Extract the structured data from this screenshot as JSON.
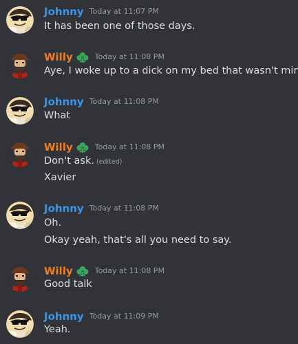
{
  "colors": {
    "background": "#313338",
    "johnny_name": "#3b95e6",
    "willy_name": "#ef7b21",
    "badge": "#3ba55d",
    "timestamp": "#949ba4",
    "text": "#dbdee1"
  },
  "messages": [
    {
      "author": "Johnny",
      "timestamp": "Today at 11:07 PM",
      "avatar_icon": "johnny-avatar-icon",
      "lines": [
        "It has been one of those days."
      ]
    },
    {
      "author": "Willy",
      "badge_icon": "leaf-badge-icon",
      "timestamp": "Today at 11:08 PM",
      "avatar_icon": "willy-avatar-icon",
      "lines": [
        "Aye, I woke up to a dick on my bed that wasn't mine"
      ]
    },
    {
      "author": "Johnny",
      "timestamp": "Today at 11:08 PM",
      "avatar_icon": "johnny-avatar-icon",
      "lines": [
        "What"
      ]
    },
    {
      "author": "Willy",
      "badge_icon": "leaf-badge-icon",
      "timestamp": "Today at 11:08 PM",
      "avatar_icon": "willy-avatar-icon",
      "lines": [
        "Don't ask.",
        "Xavier"
      ],
      "edited_label": "(edited)"
    },
    {
      "author": "Johnny",
      "timestamp": "Today at 11:08 PM",
      "avatar_icon": "johnny-avatar-icon",
      "lines": [
        "Oh.",
        "Okay yeah, that's all you need to say."
      ]
    },
    {
      "author": "Willy",
      "badge_icon": "leaf-badge-icon",
      "timestamp": "Today at 11:08 PM",
      "avatar_icon": "willy-avatar-icon",
      "lines": [
        "Good talk"
      ]
    },
    {
      "author": "Johnny",
      "timestamp": "Today at 11:09 PM",
      "avatar_icon": "johnny-avatar-icon",
      "lines": [
        "Yeah."
      ]
    }
  ]
}
